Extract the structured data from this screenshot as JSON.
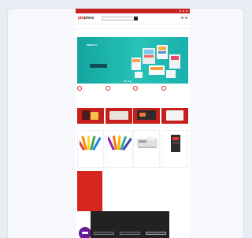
{
  "topbar": {},
  "header": {
    "logo_part_a": "pixl",
    "logo_part_b": "press"
  },
  "banner": {
    "title": "PRESS.A"
  },
  "features": [
    {
      "icon": "truck-icon"
    },
    {
      "icon": "tag-icon"
    },
    {
      "icon": "shield-icon"
    },
    {
      "icon": "headset-icon"
    }
  ],
  "categories": [
    {},
    {},
    {},
    {}
  ],
  "products": [
    {
      "image": "color-swatch-fan"
    },
    {
      "image": "color-swatch-fan"
    },
    {
      "image": "card-printer"
    },
    {
      "image": "lamination-machine"
    }
  ],
  "colors": {
    "brand_red": "#d7261e",
    "banner_teal": "#1bb0ad",
    "cookie_bg": "#222222"
  }
}
